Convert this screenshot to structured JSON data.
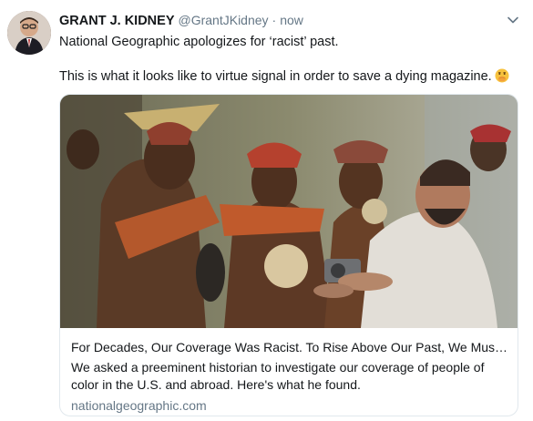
{
  "tweet": {
    "author_name": "GRANT J. KIDNEY",
    "author_handle": "@GrantJKidney",
    "separator": "·",
    "timestamp": "now",
    "text_line_1": "National Geographic apologizes for ‘racist’ past.",
    "text_line_2": "This is what it looks like to virtue signal in order to save a dying magazine.",
    "emoji": "face-with-hand-over-mouth-icon"
  },
  "card": {
    "title": "For Decades, Our Coverage Was Racist. To Rise Above Our Past, We Must …",
    "description": "We asked a preeminent historian to investigate our coverage of people of color in the U.S. and abroad. Here's what he found.",
    "domain": "nationalgeographic.com",
    "image": "photo-of-tribesmen-and-photographer"
  },
  "colors": {
    "text_primary": "#14171a",
    "text_secondary": "#657786",
    "card_border": "#e1e8ed"
  }
}
